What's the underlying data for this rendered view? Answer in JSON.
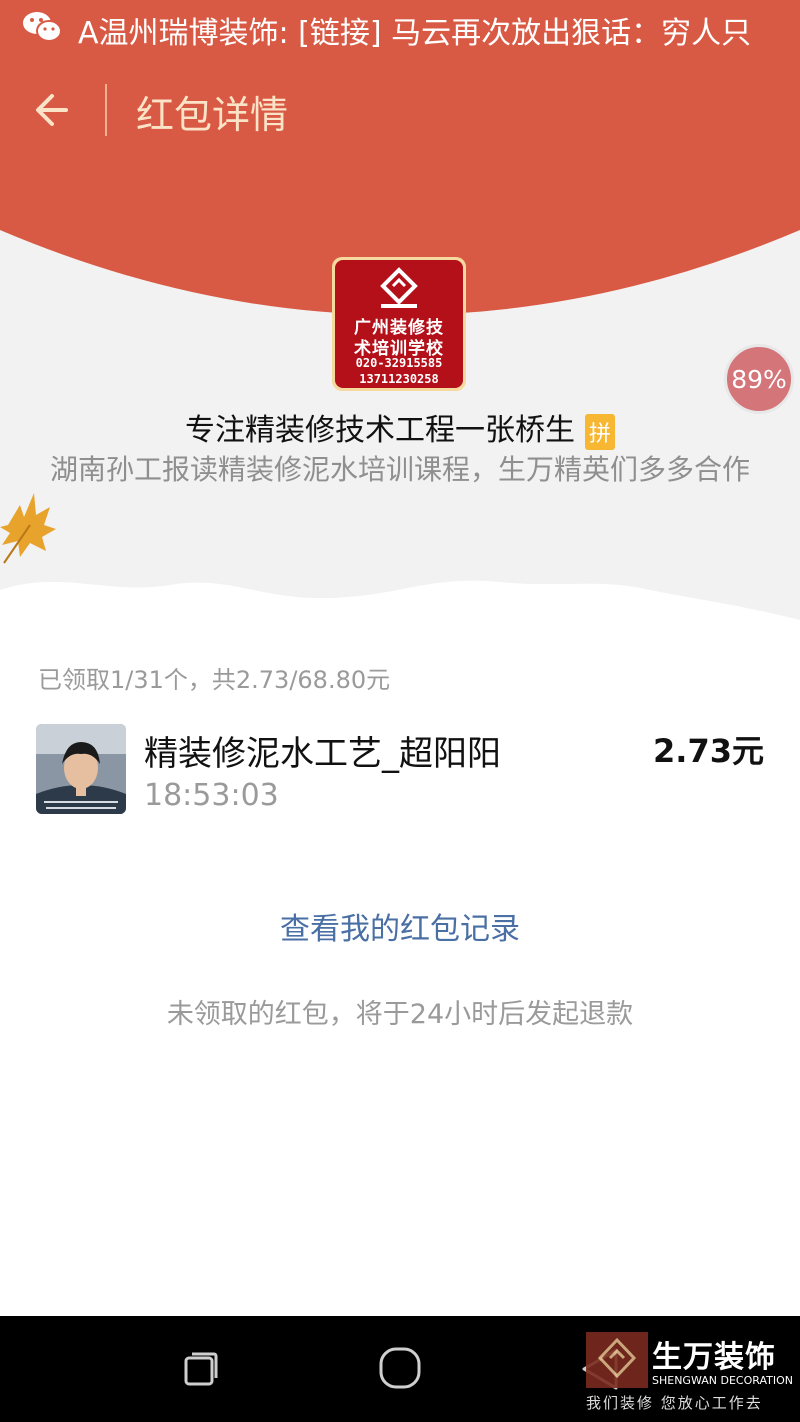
{
  "colors": {
    "accent_red": "#d95a44",
    "link_blue": "#4a6fa5",
    "badge_yellow": "#f7b733"
  },
  "notification": {
    "icon": "wechat-icon",
    "text": "A温州瑞博装饰: [链接] 马云再次放出狠话：穷人只"
  },
  "header": {
    "back_icon": "back-arrow-icon",
    "title": "红包详情"
  },
  "logo": {
    "line1": "广州装修技",
    "line2": "术培训学校",
    "phone1": "020-32915585",
    "phone2": "13711230258"
  },
  "progress_badge": "89%",
  "sender": {
    "name": "专注精装修技术工程一张桥生",
    "tag": "拼"
  },
  "greeting": "湖南孙工报读精装修泥水培训课程，生万精英们多多合作",
  "summary": "已领取1/31个，共2.73/68.80元",
  "records": [
    {
      "name": "精装修泥水工艺_超阳阳",
      "time": "18:53:03",
      "amount": "2.73元"
    }
  ],
  "link": "查看我的红包记录",
  "notice": "未领取的红包，将于24小时后发起退款",
  "navbar": {
    "recent": "recent-apps-icon",
    "home": "home-icon",
    "back": "back-triangle-icon"
  },
  "watermark": {
    "brand": "生万装饰",
    "english": "SHENGWAN DECORATION",
    "slogan": "我们装修 您放心工作去"
  }
}
